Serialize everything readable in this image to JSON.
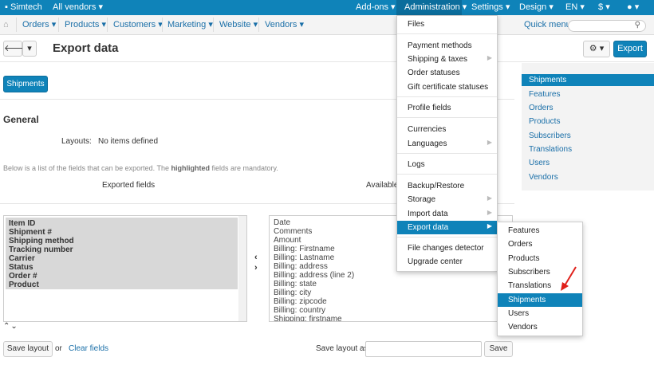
{
  "topbar": {
    "store": "Simtech",
    "vendors": "All vendors",
    "addons": "Add-ons",
    "administration": "Administration",
    "settings": "Settings",
    "design": "Design",
    "lang": "EN",
    "currency": "$"
  },
  "nav": {
    "orders": "Orders",
    "products": "Products",
    "customers": "Customers",
    "marketing": "Marketing",
    "website": "Website",
    "vendors": "Vendors",
    "quick_menu": "Quick menu"
  },
  "page": {
    "title": "Export data",
    "export_button": "Export",
    "tab": "Shipments",
    "section": "General",
    "layouts_label": "Layouts:",
    "layouts_value": "No items defined",
    "note_pre": "Below is a list of the fields that can be exported. The ",
    "note_bold": "highlighted",
    "note_post": " fields are mandatory.",
    "exported_fields": "Exported fields",
    "available_fields": "Available f",
    "save_layout": "Save layout",
    "or": "or",
    "clear_fields": "Clear fields",
    "save_layout_as": "Save layout as:",
    "save": "Save"
  },
  "exported_list": [
    "Item ID",
    "Shipment #",
    "Shipping method",
    "Tracking number",
    "Carrier",
    "Status",
    "Order #",
    "Product"
  ],
  "available_list": [
    "Date",
    "Comments",
    "Amount",
    "Billing: Firstname",
    "Billing: Lastname",
    "Billing: address",
    "Billing: address (line 2)",
    "Billing: state",
    "Billing: city",
    "Billing: zipcode",
    "Billing: country",
    "Shipping: firstname"
  ],
  "sidebar": [
    "Shipments",
    "Features",
    "Orders",
    "Products",
    "Subscribers",
    "Translations",
    "Users",
    "Vendors"
  ],
  "admin_menu": {
    "files": "Files",
    "payment_methods": "Payment methods",
    "shipping_taxes": "Shipping & taxes",
    "order_statuses": "Order statuses",
    "gift_cert": "Gift certificate statuses",
    "profile_fields": "Profile fields",
    "currencies": "Currencies",
    "languages": "Languages",
    "logs": "Logs",
    "backup": "Backup/Restore",
    "storage": "Storage",
    "import_data": "Import data",
    "export_data": "Export data",
    "file_changes": "File changes detector",
    "upgrade": "Upgrade center"
  },
  "export_submenu": [
    "Features",
    "Orders",
    "Products",
    "Subscribers",
    "Translations",
    "Shipments",
    "Users",
    "Vendors"
  ],
  "colors": {
    "accent": "#0f83b9",
    "link": "#1a6fa8",
    "pointer": "#e0201a"
  }
}
